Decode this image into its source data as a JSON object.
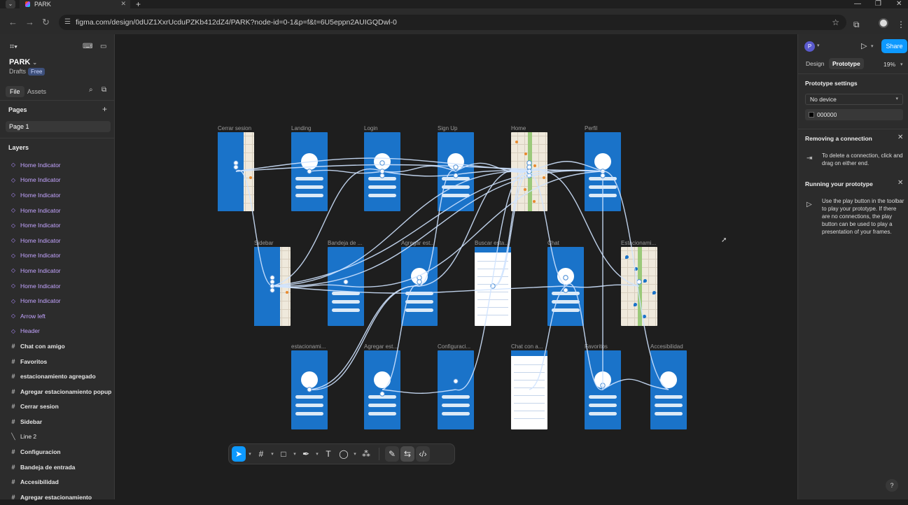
{
  "browser": {
    "tab_title": "PARK",
    "url": "figma.com/design/0dUZ1XxrUcduPZKb412dZ4/PARK?node-id=0-1&p=f&t=6U5eppn2AUIGQDwl-0"
  },
  "file": {
    "name": "PARK",
    "location": "Drafts",
    "plan_badge": "Free",
    "tabs": [
      "File",
      "Assets"
    ]
  },
  "pages": {
    "title": "Pages",
    "items": [
      "Page 1"
    ]
  },
  "layers": {
    "title": "Layers",
    "items": [
      {
        "label": "Home Indicator",
        "kind": "component"
      },
      {
        "label": "Home Indicator",
        "kind": "component"
      },
      {
        "label": "Home Indicator",
        "kind": "component"
      },
      {
        "label": "Home Indicator",
        "kind": "component"
      },
      {
        "label": "Home Indicator",
        "kind": "component"
      },
      {
        "label": "Home Indicator",
        "kind": "component"
      },
      {
        "label": "Home Indicator",
        "kind": "component"
      },
      {
        "label": "Home Indicator",
        "kind": "component"
      },
      {
        "label": "Home Indicator",
        "kind": "component"
      },
      {
        "label": "Home Indicator",
        "kind": "component"
      },
      {
        "label": "Arrow left",
        "kind": "component"
      },
      {
        "label": "Header",
        "kind": "component"
      },
      {
        "label": "Chat con amigo",
        "kind": "frame"
      },
      {
        "label": "Favoritos",
        "kind": "frame"
      },
      {
        "label": "estacionamiento agregado",
        "kind": "frame"
      },
      {
        "label": "Agregar estacionamiento popup",
        "kind": "frame"
      },
      {
        "label": "Cerrar sesion",
        "kind": "frame"
      },
      {
        "label": "Sidebar",
        "kind": "frame"
      },
      {
        "label": "Line 2",
        "kind": "line"
      },
      {
        "label": "Configuracion",
        "kind": "frame"
      },
      {
        "label": "Bandeja de entrada",
        "kind": "frame"
      },
      {
        "label": "Accesibilidad",
        "kind": "frame"
      },
      {
        "label": "Agregar estacionamiento",
        "kind": "frame"
      }
    ]
  },
  "canvas": {
    "frames": [
      {
        "label": "Cerrar sesion",
        "style": "map"
      },
      {
        "label": "Landing",
        "style": "blue"
      },
      {
        "label": "Login",
        "style": "blue"
      },
      {
        "label": "Sign Up",
        "style": "blue"
      },
      {
        "label": "Home",
        "style": "map"
      },
      {
        "label": "Perfil",
        "style": "blue"
      },
      {
        "label": "Sidebar",
        "style": "map"
      },
      {
        "label": "Bandeja de ...",
        "style": "blue"
      },
      {
        "label": "Agregar est...",
        "style": "blue"
      },
      {
        "label": "Buscar esta...",
        "style": "white"
      },
      {
        "label": "Chat",
        "style": "blue"
      },
      {
        "label": "Estacionami...",
        "style": "map"
      },
      {
        "label": "estacionami...",
        "style": "blue"
      },
      {
        "label": "Agregar est...",
        "style": "blue"
      },
      {
        "label": "Configuraci...",
        "style": "blue"
      },
      {
        "label": "Chat con a...",
        "style": "white"
      },
      {
        "label": "Favoritos",
        "style": "blue"
      },
      {
        "label": "Accesibilidad",
        "style": "blue"
      }
    ],
    "frame_text": {
      "login_welcome": "BIENVENIDO!",
      "signup_title": "REGÍSTRATE Y FORMA PARTE DE LA COMUNIDAD FINDER",
      "accesibilidad_title": "Accesibilidad",
      "agregado_title": "Estacionamiento Agregado",
      "config_title": "Configuración",
      "chat_title": "Chat"
    }
  },
  "toolbar": {
    "tools": [
      "move",
      "frame",
      "shape",
      "pen",
      "text",
      "comment",
      "actions",
      "design-mode",
      "prototype-mode",
      "dev-mode"
    ]
  },
  "right_panel": {
    "avatar_initial": "P",
    "share_label": "Share",
    "tabs": [
      "Design",
      "Prototype"
    ],
    "active_tab": "Prototype",
    "zoom": "19%",
    "prototype_settings": {
      "title": "Prototype settings",
      "device": "No device",
      "background": "000000"
    },
    "removing_connection": {
      "title": "Removing a connection",
      "text": "To delete a connection, click and drag on either end."
    },
    "running_prototype": {
      "title": "Running your prototype",
      "text": "Use the play button in the toolbar to play your prototype. If there are no connections, the play button can be used to play a presentation of your frames."
    },
    "help_label": "?"
  },
  "colors": {
    "accent": "#0d99ff",
    "frame_blue": "#1a73c9",
    "wire": "#cfe3ff",
    "component": "#c3a4ff"
  }
}
